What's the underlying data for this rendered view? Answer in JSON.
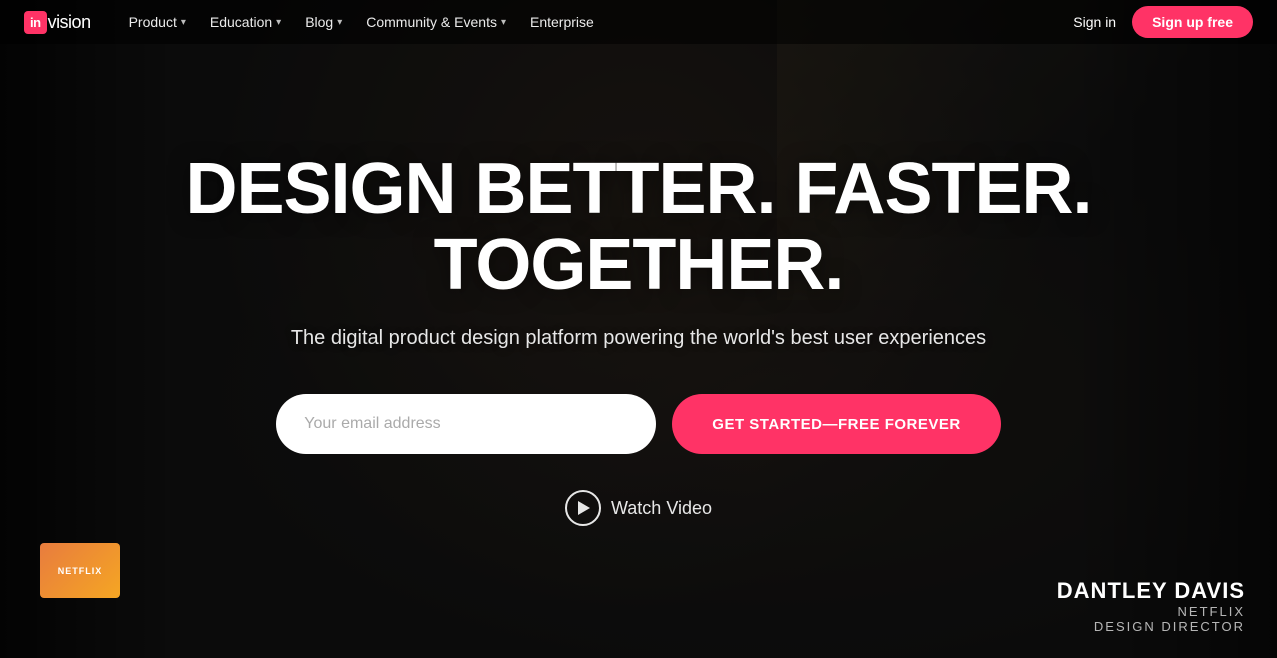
{
  "logo": {
    "in_box": "in",
    "vision_text": "vision"
  },
  "nav": {
    "links": [
      {
        "label": "Product",
        "has_dropdown": true,
        "id": "product"
      },
      {
        "label": "Education",
        "has_dropdown": true,
        "id": "education"
      },
      {
        "label": "Blog",
        "has_dropdown": true,
        "id": "blog"
      },
      {
        "label": "Community & Events",
        "has_dropdown": true,
        "id": "community"
      },
      {
        "label": "Enterprise",
        "has_dropdown": false,
        "id": "enterprise"
      }
    ],
    "sign_in": "Sign in",
    "sign_up": "Sign up free"
  },
  "hero": {
    "title": "DESIGN BETTER. FASTER. TOGETHER.",
    "subtitle": "The digital product design platform powering the world's best user experiences",
    "email_placeholder": "Your email address",
    "cta_label": "GET STARTED—FREE FOREVER",
    "watch_video_label": "Watch Video"
  },
  "credit": {
    "name": "DANTLEY DAVIS",
    "company": "NETFLIX",
    "title": "DESIGN DIRECTOR"
  },
  "colors": {
    "accent": "#ff3366",
    "nav_bg": "rgba(0,0,0,0.55)",
    "overlay": "rgba(0,0,0,0.55)"
  }
}
